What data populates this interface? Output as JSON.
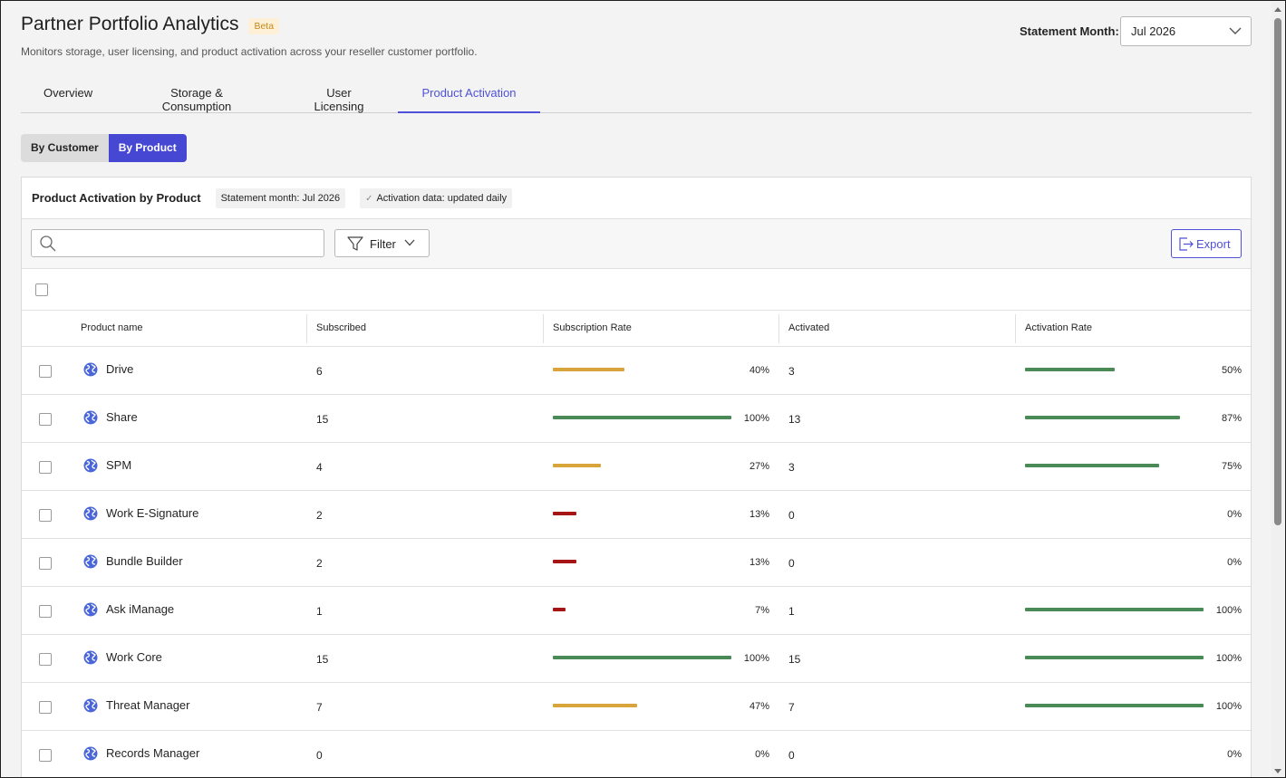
{
  "header": {
    "title": "Partner Portfolio Analytics",
    "badge": "Beta",
    "subtitle": "Monitors storage, user licensing, and product activation across your reseller customer portfolio.",
    "statement_month_label": "Statement Month:",
    "statement_month_value": "Jul 2026"
  },
  "tabs": [
    {
      "label": "Overview",
      "active": false
    },
    {
      "label": "Storage & Consumption",
      "active": false
    },
    {
      "label": "User Licensing",
      "active": false
    },
    {
      "label": "Product Activation",
      "active": true
    }
  ],
  "view_toggle": {
    "by_customer": "By Customer",
    "by_product": "By Product",
    "selected": "By Product"
  },
  "panel": {
    "title": "Product Activation by Product",
    "chip_month": "Statement month: Jul 2026",
    "chip_update": "Activation data: updated daily"
  },
  "toolbar": {
    "search_placeholder": "",
    "filter_label": "Filter",
    "export_label": "Export"
  },
  "table": {
    "columns": [
      "Product name",
      "Subscribed",
      "Subscription Rate",
      "Activated",
      "Activation Rate"
    ],
    "rows": [
      {
        "name": "Drive",
        "subscribed": "6",
        "sub_rate": 40,
        "sub_rate_label": "40%",
        "activated": "3",
        "act_rate": 50,
        "act_rate_label": "50%"
      },
      {
        "name": "Share",
        "subscribed": "15",
        "sub_rate": 100,
        "sub_rate_label": "100%",
        "activated": "13",
        "act_rate": 87,
        "act_rate_label": "87%"
      },
      {
        "name": "SPM",
        "subscribed": "4",
        "sub_rate": 27,
        "sub_rate_label": "27%",
        "activated": "3",
        "act_rate": 75,
        "act_rate_label": "75%"
      },
      {
        "name": "Work E-Signature",
        "subscribed": "2",
        "sub_rate": 13,
        "sub_rate_label": "13%",
        "activated": "0",
        "act_rate": 0,
        "act_rate_label": "0%"
      },
      {
        "name": "Bundle Builder",
        "subscribed": "2",
        "sub_rate": 13,
        "sub_rate_label": "13%",
        "activated": "0",
        "act_rate": 0,
        "act_rate_label": "0%"
      },
      {
        "name": "Ask iManage",
        "subscribed": "1",
        "sub_rate": 7,
        "sub_rate_label": "7%",
        "activated": "1",
        "act_rate": 100,
        "act_rate_label": "100%"
      },
      {
        "name": "Work Core",
        "subscribed": "15",
        "sub_rate": 100,
        "sub_rate_label": "100%",
        "activated": "15",
        "act_rate": 100,
        "act_rate_label": "100%"
      },
      {
        "name": "Threat Manager",
        "subscribed": "7",
        "sub_rate": 47,
        "sub_rate_label": "47%",
        "activated": "7",
        "act_rate": 100,
        "act_rate_label": "100%"
      },
      {
        "name": "Records Manager",
        "subscribed": "0",
        "sub_rate": 0,
        "sub_rate_label": "0%",
        "activated": "0",
        "act_rate": 0,
        "act_rate_label": "0%"
      }
    ]
  },
  "colors": {
    "accent": "#4f52d9",
    "bar_green": "#4a8a57",
    "bar_amber": "#d9a53a",
    "bar_red": "#a51515",
    "globe": "#4a66d8"
  }
}
